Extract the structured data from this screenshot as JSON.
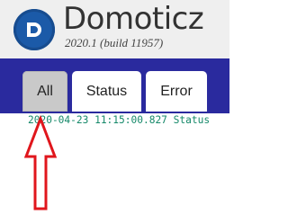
{
  "header": {
    "app_name": "Domoticz",
    "version": "2020.1 (build 11957)",
    "logo_icon": "domoticz-logo-icon"
  },
  "tabs": [
    {
      "label": "All",
      "selected": true
    },
    {
      "label": "Status",
      "selected": false
    },
    {
      "label": "Error",
      "selected": false
    }
  ],
  "log": {
    "line": "2020-04-23 11:15:00.827 Status"
  },
  "annotation": {
    "icon": "red-arrow-icon",
    "color": "#e0161c"
  },
  "colors": {
    "navbar": "#2a2a9e",
    "log_text": "#16896a",
    "logo": "#1b5aa8"
  }
}
